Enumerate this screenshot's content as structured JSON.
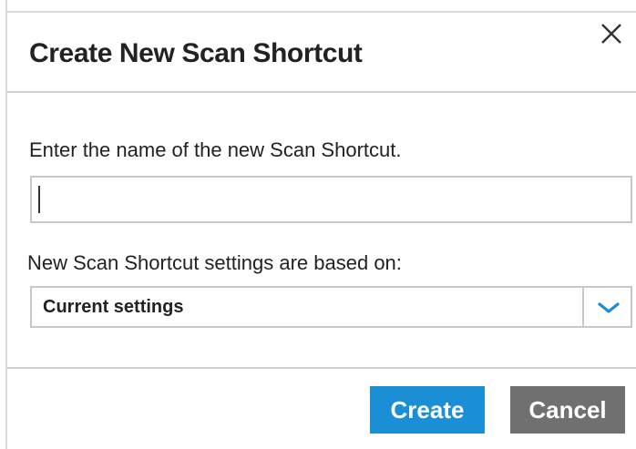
{
  "dialog": {
    "title": "Create New Scan Shortcut",
    "close_icon": "close-icon"
  },
  "name_field": {
    "label": "Enter the name of the new Scan Shortcut.",
    "value": "",
    "placeholder": ""
  },
  "settings_select": {
    "label": "New Scan Shortcut settings are based on:",
    "selected": "Current settings",
    "icon": "chevron-down-icon"
  },
  "buttons": {
    "create": "Create",
    "cancel": "Cancel"
  },
  "colors": {
    "primary": "#1a8fd6",
    "secondary": "#707070",
    "chevron": "#1a8fd6"
  }
}
